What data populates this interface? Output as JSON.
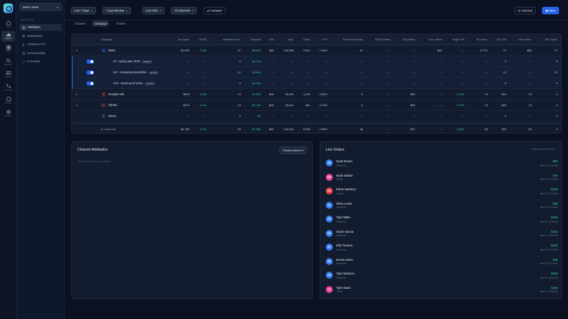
{
  "rail": {
    "items": [
      {
        "label": "Home",
        "icon": "home-icon"
      },
      {
        "label": "Analytics",
        "icon": "bar-chart-icon"
      },
      {
        "label": "Tiles",
        "icon": "grid-icon"
      },
      {
        "label": "Research",
        "icon": "search-icon"
      },
      {
        "label": "Creatives",
        "icon": "image-icon"
      },
      {
        "label": "Journeys",
        "icon": "route-icon"
      },
      {
        "label": "Products",
        "icon": "box-icon"
      },
      {
        "label": "Settings",
        "icon": "gear-icon"
      }
    ]
  },
  "sidebar": {
    "store": "Demo Store",
    "section_label": "ANALYTICS",
    "items": [
      {
        "label": "Attribution",
        "icon": "target-icon"
      },
      {
        "label": "Multi-Brand",
        "icon": "layers-icon"
      },
      {
        "label": "Customer LTV",
        "icon": "users-icon"
      },
      {
        "label": "Incrementality",
        "icon": "flask-icon"
      },
      {
        "label": "Forecasts",
        "icon": "trend-icon"
      }
    ]
  },
  "toolbar": {
    "date_range": "Last 7 Days",
    "window": "7 Day Window",
    "model": "Last Click",
    "channels": "All Channels",
    "compare": "Compare",
    "columns": "Columns",
    "save": "Save"
  },
  "tabs": [
    "Channel",
    "Campaign",
    "Orders"
  ],
  "table": {
    "columns": [
      "Campaign",
      "Ad Spend",
      "ROAS",
      "Attributed Conv.",
      "Revenue",
      "CPA",
      "Impr.",
      "Clicks",
      "CTR",
      "Purchases (Meta)",
      "ROAS (Meta)",
      "CPA (Meta)",
      "Conv. Value",
      "Page CVR",
      "NC Purch.",
      "NC CPA",
      "New Purch.",
      "Ret. Purch."
    ],
    "rows": [
      {
        "type": "channel",
        "expander": "▾",
        "icon_text": "M",
        "icon_color": "#1877f2",
        "name": "Meta",
        "values": [
          "$1,620",
          "2.48x",
          "27",
          "$3,630",
          "$60",
          "140,536",
          "3,491",
          "2.48%",
          "42",
          "—",
          "—",
          "$44",
          "—",
          "0.77%",
          "27",
          "$60",
          "27",
          "0"
        ]
      },
      {
        "type": "ad",
        "name": "tof - spring sale 2026",
        "status": "paused",
        "values": [
          "—",
          "—",
          "9",
          "$1,133",
          "—",
          "—",
          "—",
          "—",
          "—",
          "—",
          "—",
          "—",
          "—",
          "—",
          "9",
          "—",
          "9",
          "0"
        ]
      },
      {
        "type": "ad",
        "name": "bof - retargeting bestseller",
        "status": "paused",
        "values": [
          "—",
          "—",
          "12",
          "$1,640",
          "—",
          "—",
          "—",
          "—",
          "—",
          "—",
          "—",
          "—",
          "—",
          "—",
          "12",
          "—",
          "12",
          "0"
        ]
      },
      {
        "type": "ad",
        "name": "mof - social proof video",
        "status": "paused",
        "values": [
          "—",
          "—",
          "9",
          "$1,240",
          "—",
          "—",
          "—",
          "—",
          "—",
          "—",
          "—",
          "—",
          "—",
          "—",
          "9",
          "—",
          "9",
          "0"
        ]
      },
      {
        "type": "channel",
        "expander": "▸",
        "icon_text": "G",
        "icon_color": "#ea4335",
        "name": "Google Ads",
        "values": [
          "$516",
          "2.94x",
          "13",
          "$1,516",
          "$44",
          "43,615",
          "1,143",
          "2.63%",
          "0",
          "—",
          "$62",
          "—",
          "1.14%",
          "13",
          "$44",
          "13",
          "0",
          ""
        ]
      },
      {
        "type": "channel",
        "expander": "▸",
        "icon_text": "T",
        "icon_color": "#ef4444",
        "name": "TikTok",
        "values": [
          "$373",
          "5.19x",
          "13",
          "$2,146",
          "$29",
          "29,812",
          "661",
          "2.20%",
          "0",
          "—",
          "$55",
          "—",
          "1.97%",
          "13",
          "$29",
          "13",
          "0",
          ""
        ]
      },
      {
        "type": "channel",
        "expander": "",
        "icon_text": "D",
        "icon_color": "#64748b",
        "name": "Direct",
        "values": [
          "—",
          "—",
          "9",
          "$0",
          "—",
          "—",
          "—",
          "—",
          "—",
          "—",
          "—",
          "—",
          "—",
          "—",
          "9",
          "—",
          "9",
          "0"
        ]
      }
    ],
    "footer": {
      "label": "(4 channels)",
      "values": [
        "$2,780",
        "2.79x",
        "53",
        "$7,566",
        "$52",
        "215,491",
        "5,295",
        "2.46%",
        "58",
        "—",
        "$47",
        "—",
        "1.06%",
        "53",
        "$52",
        "53",
        "0",
        ""
      ]
    }
  },
  "attribution": {
    "title": "Channel Attribution",
    "model": "Position-Based",
    "empty": "Multi-touch data unavailable"
  },
  "live_orders": {
    "title": "Live Orders",
    "hint": "Refreshes every 30s",
    "orders": [
      {
        "initials": "NB",
        "color": "#3b82f6",
        "name": "Noah Brown",
        "source": "Facebook",
        "amount": "$90",
        "time": "Mar 22, 07:30 AM"
      },
      {
        "initials": "NW",
        "color": "#ec4899",
        "name": "Noah Walker",
        "source": "TikTok",
        "amount": "$70",
        "time": "Mar 22, 07:30 AM"
      },
      {
        "initials": "EM",
        "color": "#ef4444",
        "name": "Ethan Martinez",
        "source": "Google",
        "amount": "$128",
        "time": "Mar 22, 07:00 AM"
      },
      {
        "initials": "OL",
        "color": "#3b82f6",
        "name": "Olivia Lewis",
        "source": "Facebook",
        "amount": "$59",
        "time": "Mar 22, 07:00 AM"
      },
      {
        "initials": "TM",
        "color": "#3b82f6",
        "name": "Tyler Miller",
        "source": "Facebook",
        "amount": "$166",
        "time": "Mar 22, 07:00 AM"
      },
      {
        "initials": "SG",
        "color": "#3b82f6",
        "name": "Sarah Garcia",
        "source": "Facebook",
        "amount": "$160",
        "time": "Mar 22, 06:30 AM"
      },
      {
        "initials": "ET",
        "color": "#3b82f6",
        "name": "Ella Thomas",
        "source": "Facebook",
        "amount": "$103",
        "time": "Mar 22, 06:00 AM"
      },
      {
        "initials": "ED",
        "color": "#3b82f6",
        "name": "Emma Davis",
        "source": "Facebook",
        "amount": "$39",
        "time": "Mar 22, 05:30 AM"
      },
      {
        "initials": "TM",
        "color": "#3b82f6",
        "name": "Tyler Martinez",
        "source": "Facebook",
        "amount": "$206",
        "time": "Mar 22, 05:00 AM"
      },
      {
        "initials": "TD",
        "color": "#ec4899",
        "name": "Tyler Davis",
        "source": "TikTok",
        "amount": "$180",
        "time": "Mar 22, 05:00 AM"
      }
    ]
  }
}
